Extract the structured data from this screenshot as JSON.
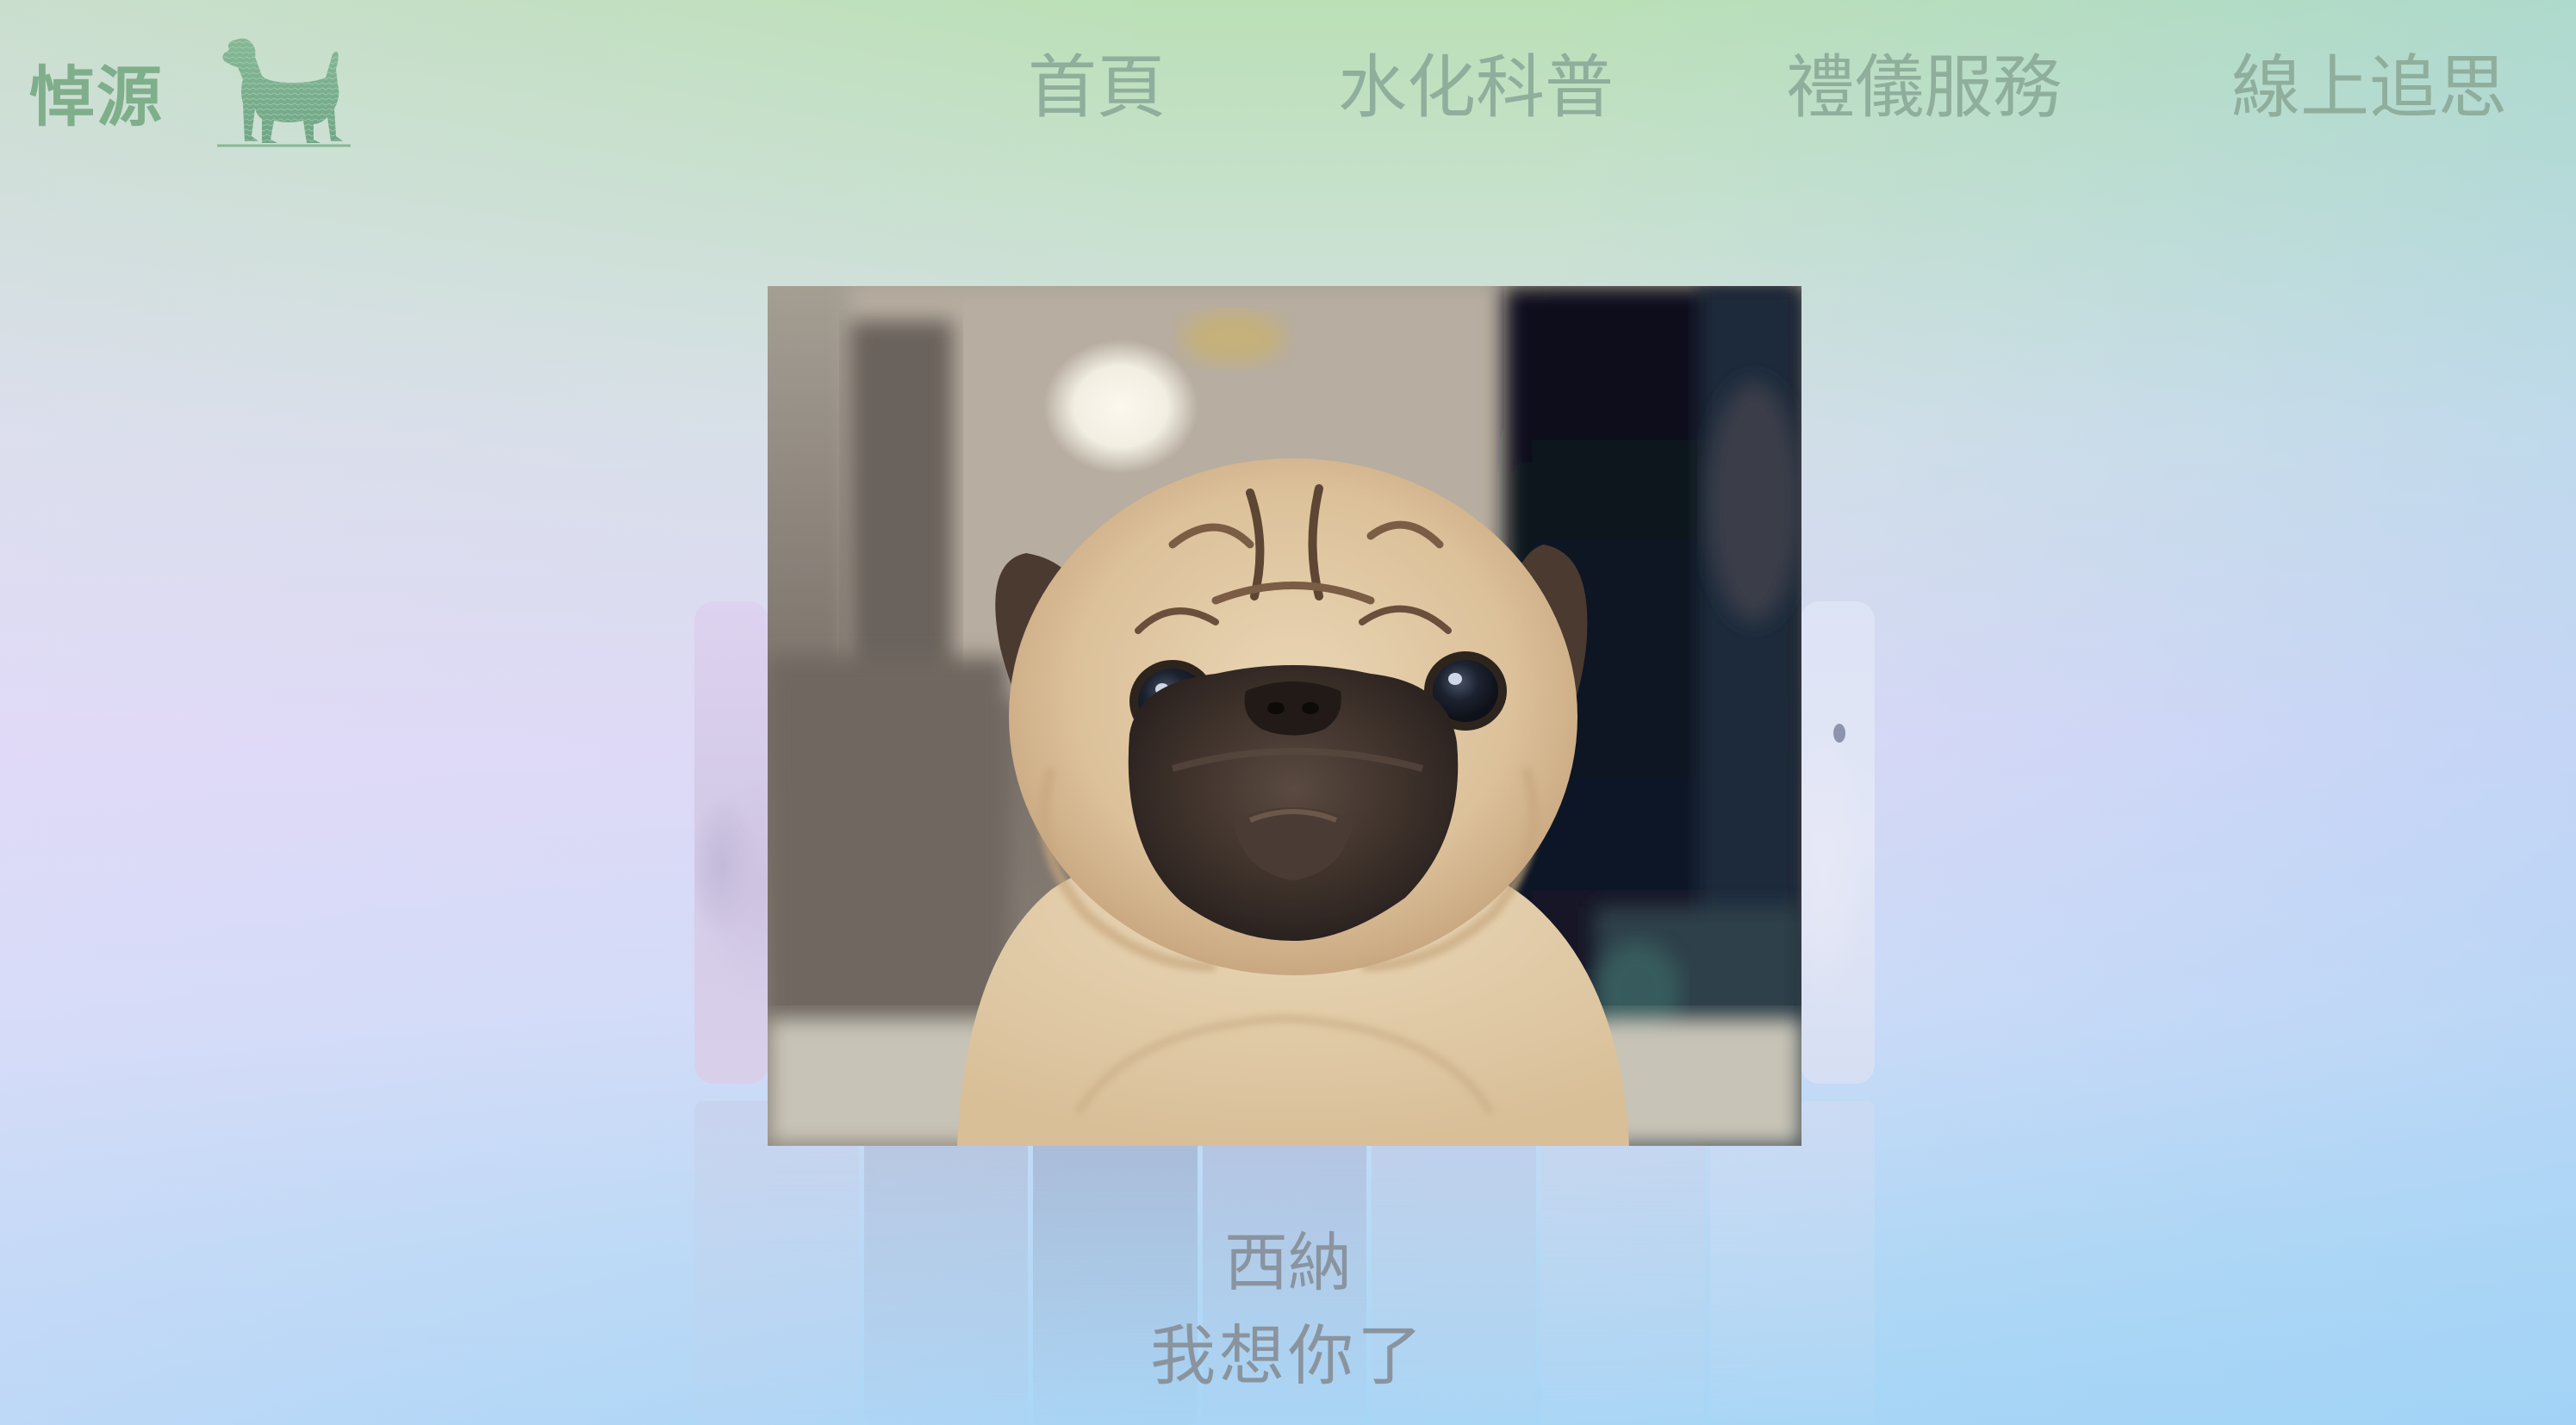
{
  "brand": {
    "name": "悼源",
    "logo_icon": "dog-logo-icon"
  },
  "nav": {
    "items": [
      {
        "label": "首頁"
      },
      {
        "label": "水化科普"
      },
      {
        "label": "禮儀服務"
      },
      {
        "label": "線上追思"
      }
    ]
  },
  "memorial": {
    "pet_name": "西納",
    "message": "我想你了",
    "photo_subject": "pug"
  },
  "colors": {
    "brand_text": "#7fae8b",
    "nav_text": "#8fae9c",
    "caption_text": "#8a949e",
    "bg_top": "#bbe0b6",
    "bg_middle": "#ddd9f6",
    "bg_bottom": "#a8d6f6"
  }
}
